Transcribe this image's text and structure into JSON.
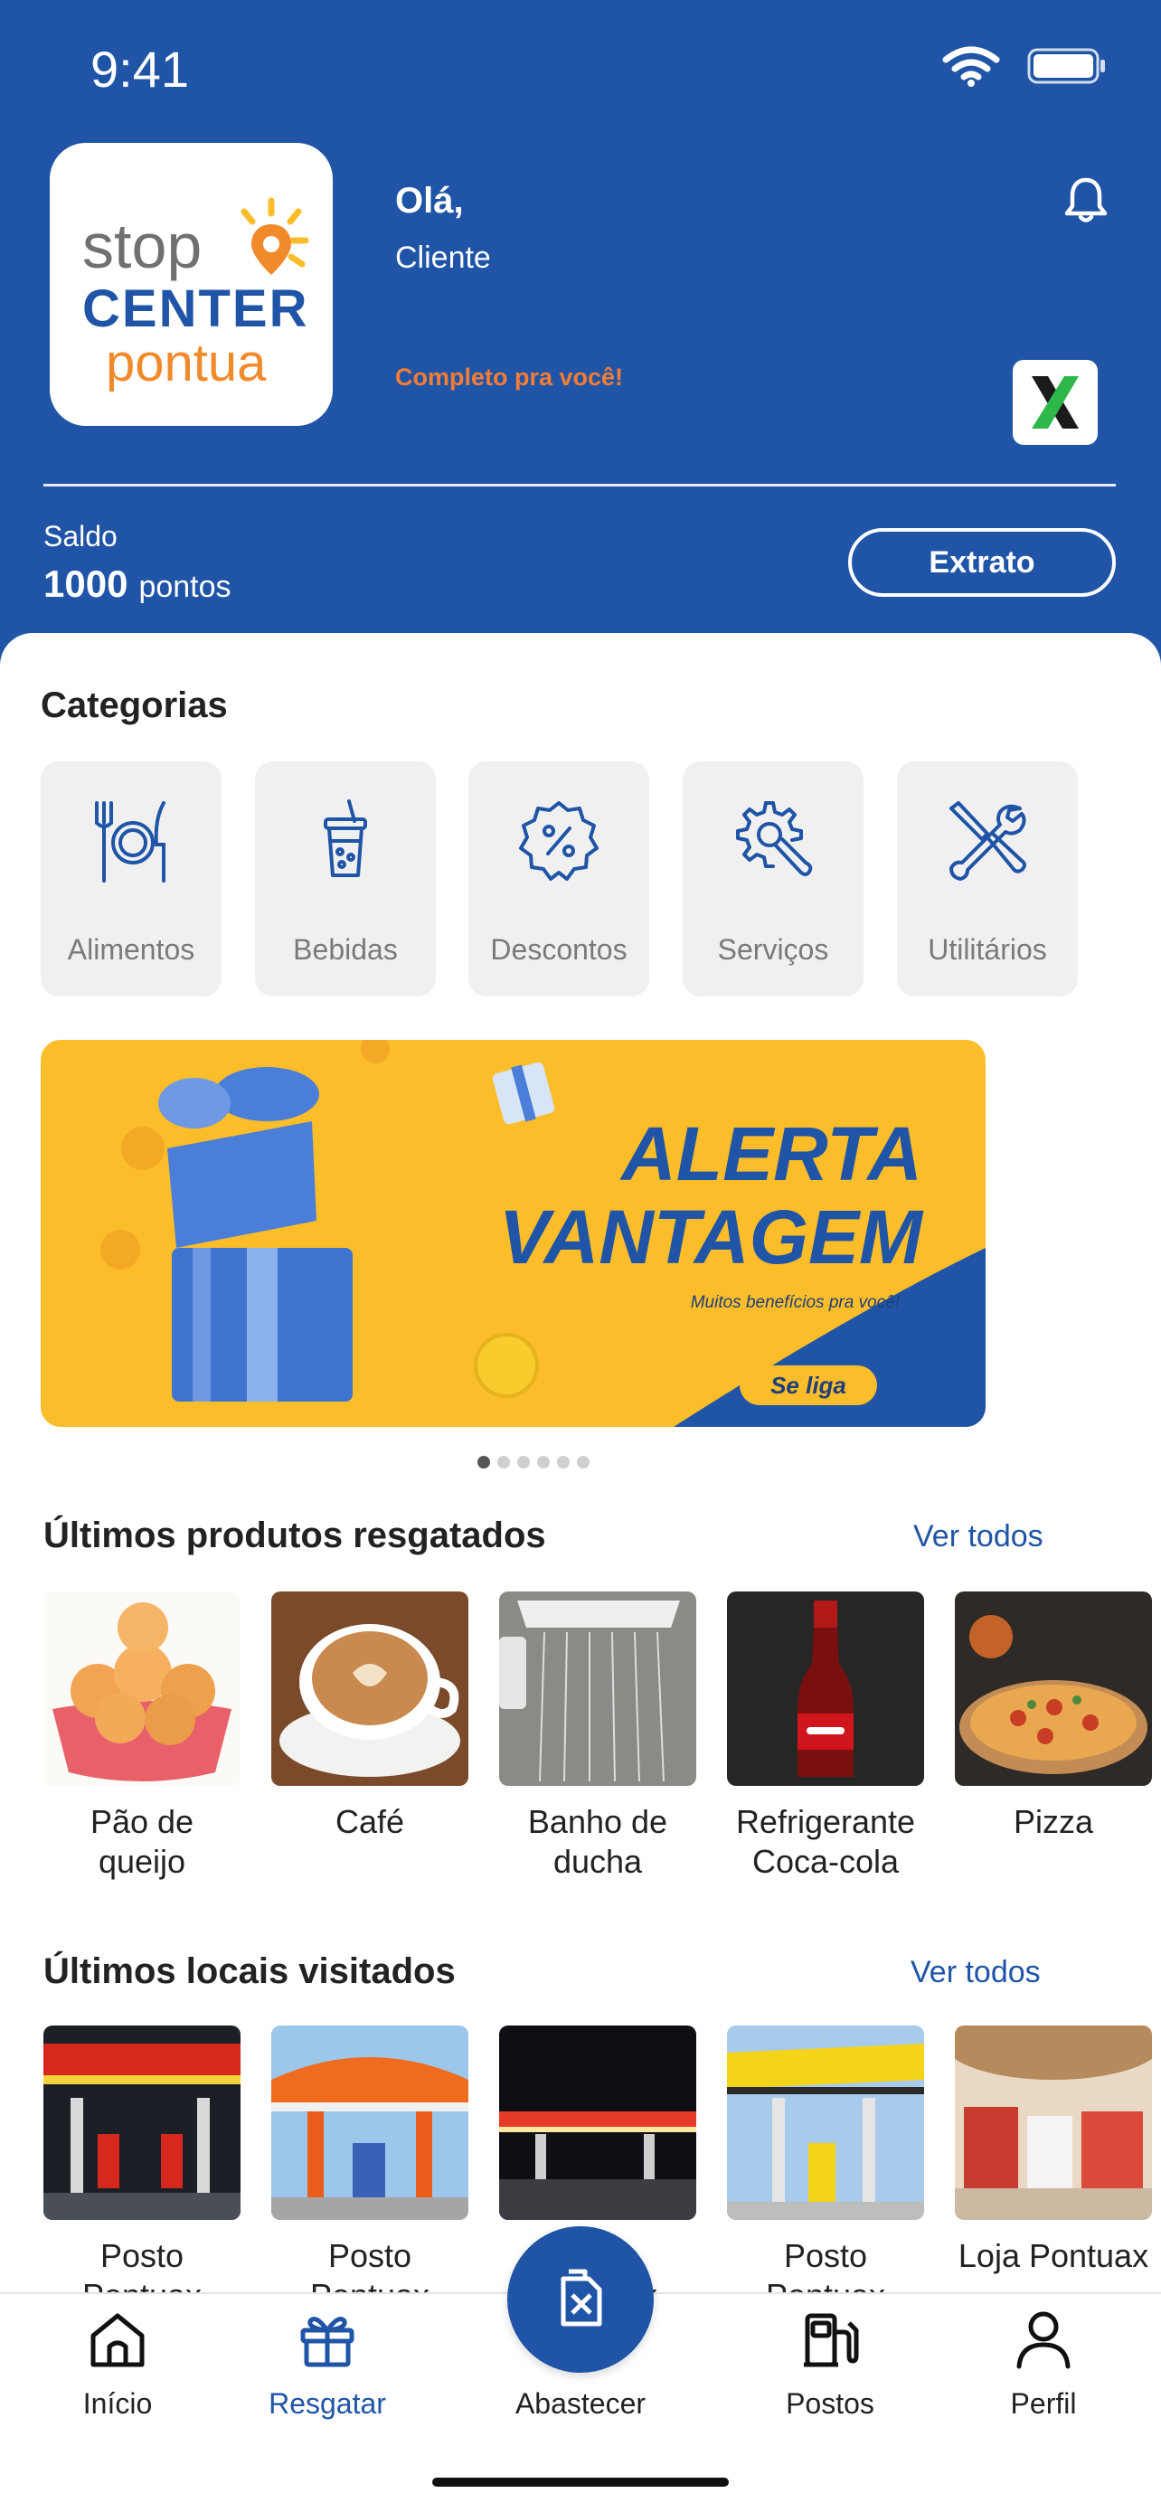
{
  "status": {
    "time": "9:41"
  },
  "brand": {
    "logo_line1": "stop",
    "logo_line2": "CENTER",
    "logo_line3": "pontua"
  },
  "header": {
    "greeting": "Olá,",
    "user": "Cliente",
    "tagline": "Completo pra você!",
    "balance_label": "Saldo",
    "balance_value": "1000",
    "balance_unit": "pontos",
    "statement_button": "Extrato"
  },
  "categories": {
    "title": "Categorias",
    "items": [
      {
        "label": "Alimentos",
        "icon": "plate-cutlery-icon"
      },
      {
        "label": "Bebidas",
        "icon": "drink-cup-icon"
      },
      {
        "label": "Descontos",
        "icon": "discount-badge-icon"
      },
      {
        "label": "Serviços",
        "icon": "gear-wrench-icon"
      },
      {
        "label": "Utilitários",
        "icon": "tools-icon"
      }
    ]
  },
  "banner": {
    "line1": "ALERTA",
    "line2": "VANTAGEM",
    "subtitle": "Muitos benefícios pra você!",
    "cta": "Se liga",
    "page_count": 6,
    "active_page": 1
  },
  "products": {
    "title": "Últimos produtos resgatados",
    "see_all": "Ver todos",
    "items": [
      {
        "label": "Pão de queijo"
      },
      {
        "label": "Café"
      },
      {
        "label": "Banho de ducha"
      },
      {
        "label": "Refrigerante Coca-cola"
      },
      {
        "label": "Pizza"
      }
    ]
  },
  "places": {
    "title": "Últimos locais visitados",
    "see_all": "Ver todos",
    "items": [
      {
        "label": "Posto Pontuax"
      },
      {
        "label": "Posto Pontuax"
      },
      {
        "label": "Posto Pontuax"
      },
      {
        "label": "Posto Pontuax"
      },
      {
        "label": "Loja Pontuax"
      }
    ]
  },
  "tabbar": {
    "items": [
      {
        "label": "Início",
        "icon": "home-icon"
      },
      {
        "label": "Resgatar",
        "icon": "gift-icon"
      },
      {
        "label": "Abastecer",
        "icon": "fuel-can-icon"
      },
      {
        "label": "Postos",
        "icon": "gas-pump-icon"
      },
      {
        "label": "Perfil",
        "icon": "user-icon"
      }
    ],
    "active": "Resgatar"
  },
  "colors": {
    "primary": "#1f54a6",
    "accent": "#f47d35",
    "banner_yellow": "#fbbd2a"
  }
}
